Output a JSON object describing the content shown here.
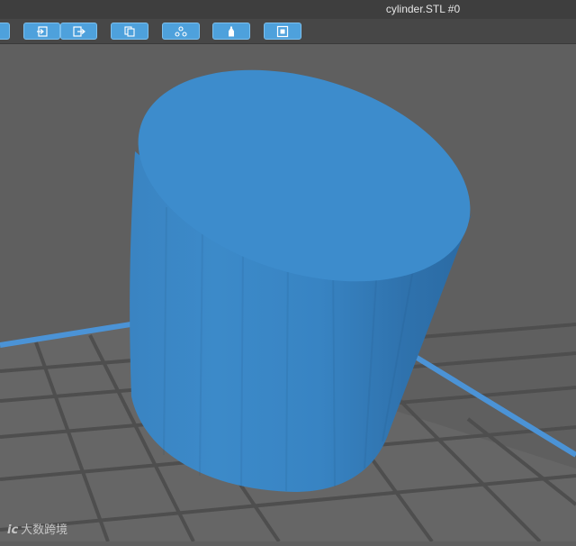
{
  "window": {
    "title": "cylinder.STL #0"
  },
  "toolbar": {
    "buttons": [
      {
        "name": "partial-button",
        "icon": "blank-icon"
      },
      {
        "name": "import-button",
        "icon": "import-icon"
      },
      {
        "name": "export-button",
        "icon": "export-icon"
      },
      {
        "name": "copy-button",
        "icon": "copy-icon"
      },
      {
        "name": "layers-button",
        "icon": "layers-icon"
      },
      {
        "name": "bottle-button",
        "icon": "bottle-icon"
      },
      {
        "name": "view-button",
        "icon": "view-icon"
      }
    ]
  },
  "model": {
    "name": "cylinder.STL",
    "color": "#3d8ccc"
  },
  "watermark": {
    "logo": "ic",
    "text": "大数跨境"
  },
  "colors": {
    "background": "#5f5f5f",
    "bed": "#666666",
    "grid": "#4e4e4e",
    "bed_edge": "#4b93d6",
    "accent": "#4ea1dc"
  }
}
